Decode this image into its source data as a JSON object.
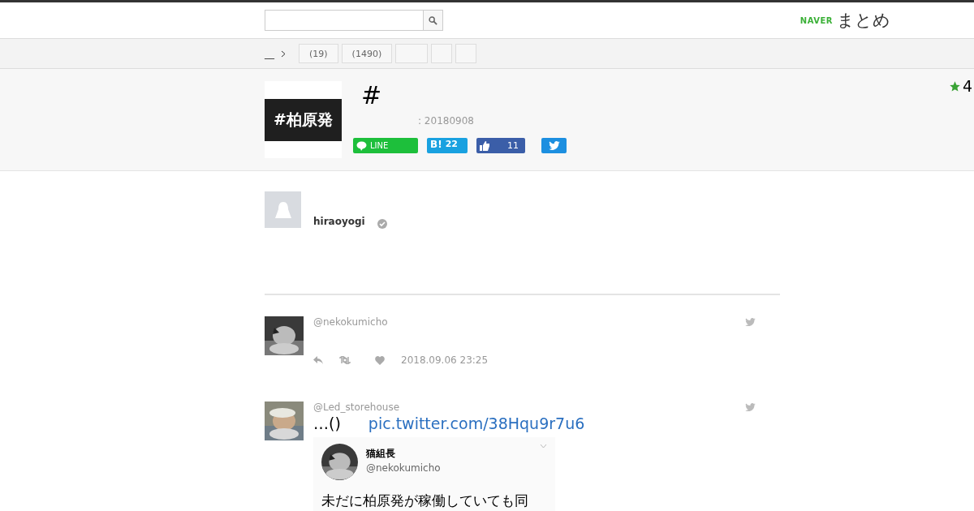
{
  "header": {
    "logo_brand": "NAVER",
    "logo_name": "まとめ"
  },
  "breadcrumb": {
    "home": "__",
    "tabs": [
      {
        "kind": "labeled",
        "label": "(19)"
      },
      {
        "kind": "labeled",
        "label": "(1490)"
      },
      {
        "kind": "blank"
      },
      {
        "kind": "blank"
      },
      {
        "kind": "blank"
      }
    ]
  },
  "favorites": {
    "count": "4"
  },
  "article": {
    "thumbnail_text": "#柏原発",
    "title": "#",
    "date": ": 20180908",
    "share": {
      "line": "LINE",
      "hatena_mark": "B!",
      "hatena_count": "22",
      "like_count": "11"
    }
  },
  "author": {
    "name": "hiraoyogi",
    "verified": true
  },
  "tweets": [
    {
      "handle": "@nekokumicho",
      "time": "2018.09.06 23:25"
    },
    {
      "handle": "@Led_storehouse",
      "text": "…()",
      "link": "pic.twitter.com/38Hqu9r7u6",
      "embed": {
        "name": "猫組長",
        "handle": "@nekokumicho",
        "text": "未だに柏原発が稼働していても同"
      }
    }
  ]
}
